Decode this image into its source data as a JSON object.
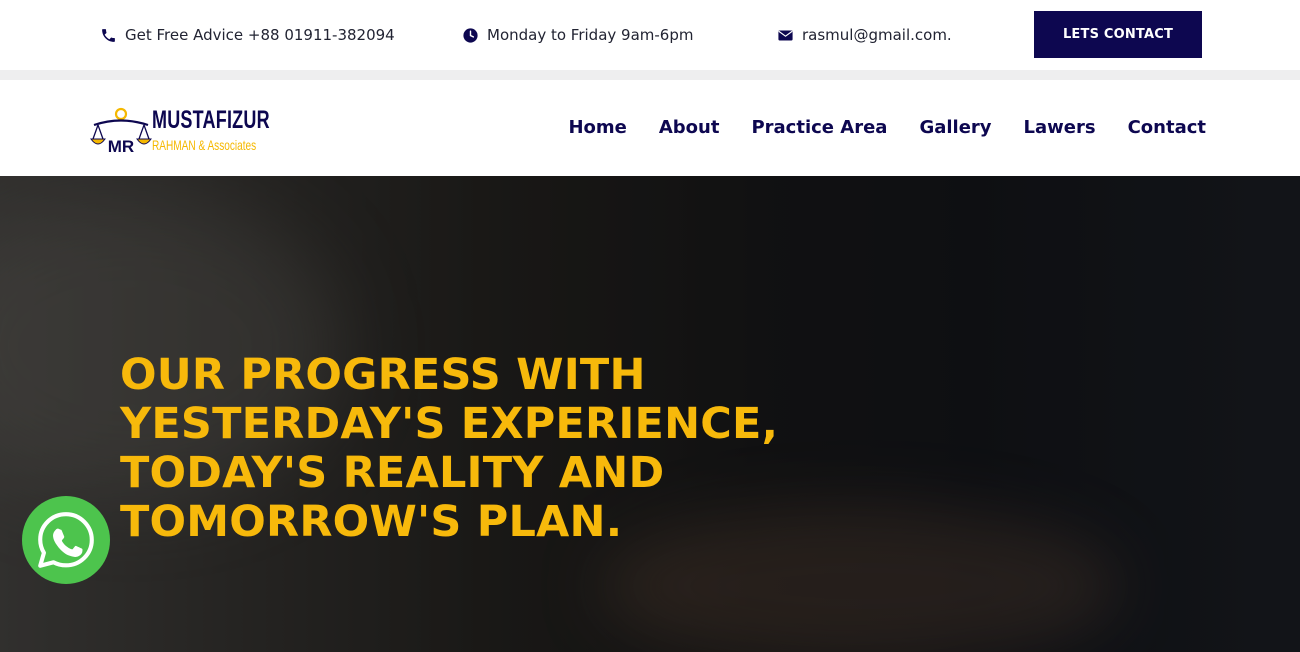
{
  "topbar": {
    "phone": {
      "icon": "phone-icon",
      "text": "Get Free Advice +88 01911-382094"
    },
    "hours": {
      "icon": "clock-icon",
      "text": "Monday to Friday 9am-6pm"
    },
    "email": {
      "icon": "envelope-icon",
      "text": "rasmul@gmail.com."
    },
    "contact_button": "LETS CONTACT"
  },
  "logo": {
    "name": "MUSTAFIZUR",
    "subtitle": "RAHMAN & Associates",
    "monogram": "MR"
  },
  "nav": {
    "items": [
      {
        "label": "Home"
      },
      {
        "label": "About"
      },
      {
        "label": "Practice Area"
      },
      {
        "label": "Gallery"
      },
      {
        "label": "Lawers"
      },
      {
        "label": "Contact"
      }
    ]
  },
  "hero": {
    "title": "OUR PROGRESS WITH YESTERDAY'S EXPERIENCE, TODAY'S REALITY AND TOMORROW'S PLAN."
  },
  "floating": {
    "icon": "whatsapp-icon"
  },
  "colors": {
    "brand_navy": "#0d0750",
    "accent_yellow": "#f7b90b",
    "whatsapp_green": "#4dc44d"
  }
}
